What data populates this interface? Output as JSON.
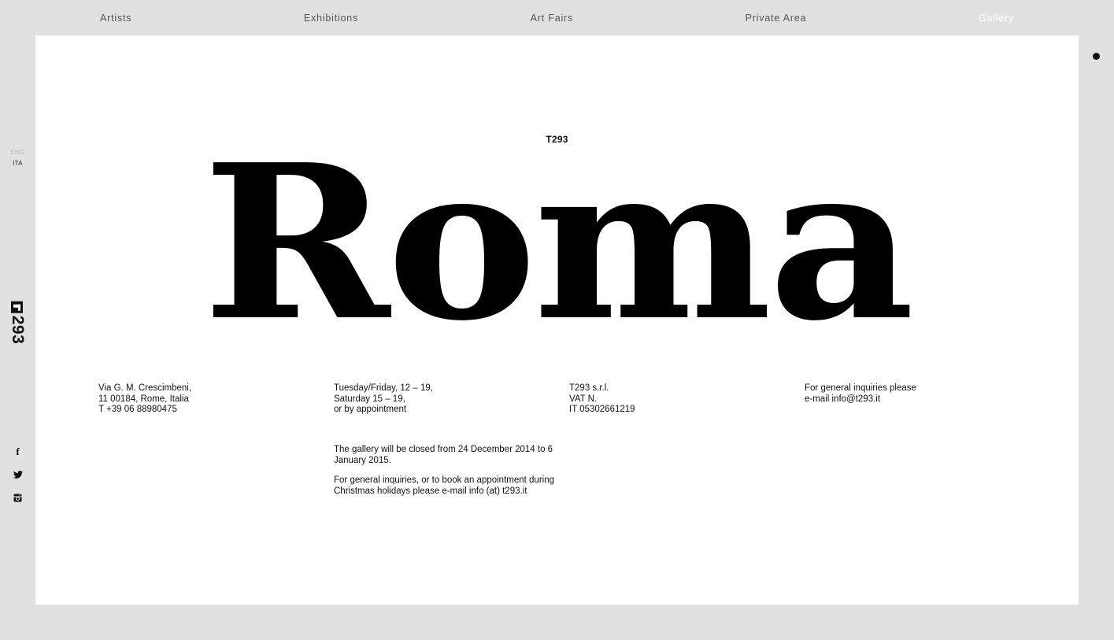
{
  "nav": {
    "items": [
      {
        "label": "Artists"
      },
      {
        "label": "Exhibitions"
      },
      {
        "label": "Art Fairs"
      },
      {
        "label": "Private Area"
      },
      {
        "label": "Gallery"
      }
    ],
    "active_index": 4
  },
  "sidebar": {
    "lang_eng": "ENG",
    "lang_ita": "ITA",
    "logo_text": "293",
    "logo_text_full": "T293",
    "social": [
      "facebook-icon",
      "twitter-icon",
      "instagram-icon"
    ]
  },
  "main": {
    "kicker": "T293",
    "hero": "Roma",
    "address": [
      "Via G. M. Crescimbeni,",
      "11 00184, Rome, Italia",
      "T +39 06 88980475"
    ],
    "hours": [
      "Tuesday/Friday, 12 – 19,",
      "Saturday 15 – 19,",
      "or by appointment"
    ],
    "company": [
      "T293 s.r.l.",
      "VAT N.",
      "IT 05302661219"
    ],
    "inquiries": [
      "For general inquiries please",
      "e-mail info@t293.it"
    ],
    "notice": [
      "The gallery will be closed from 24 December 2014 to 6 January 2015.",
      "For general inquiries, or to book an appointment during Christmas holidays please e-mail info (at) t293.it"
    ]
  },
  "colors": {
    "background": "#e1e1e2",
    "panel": "#ffffff",
    "text": "#111111",
    "nav_text": "#555555",
    "nav_active": "#ffffff"
  }
}
